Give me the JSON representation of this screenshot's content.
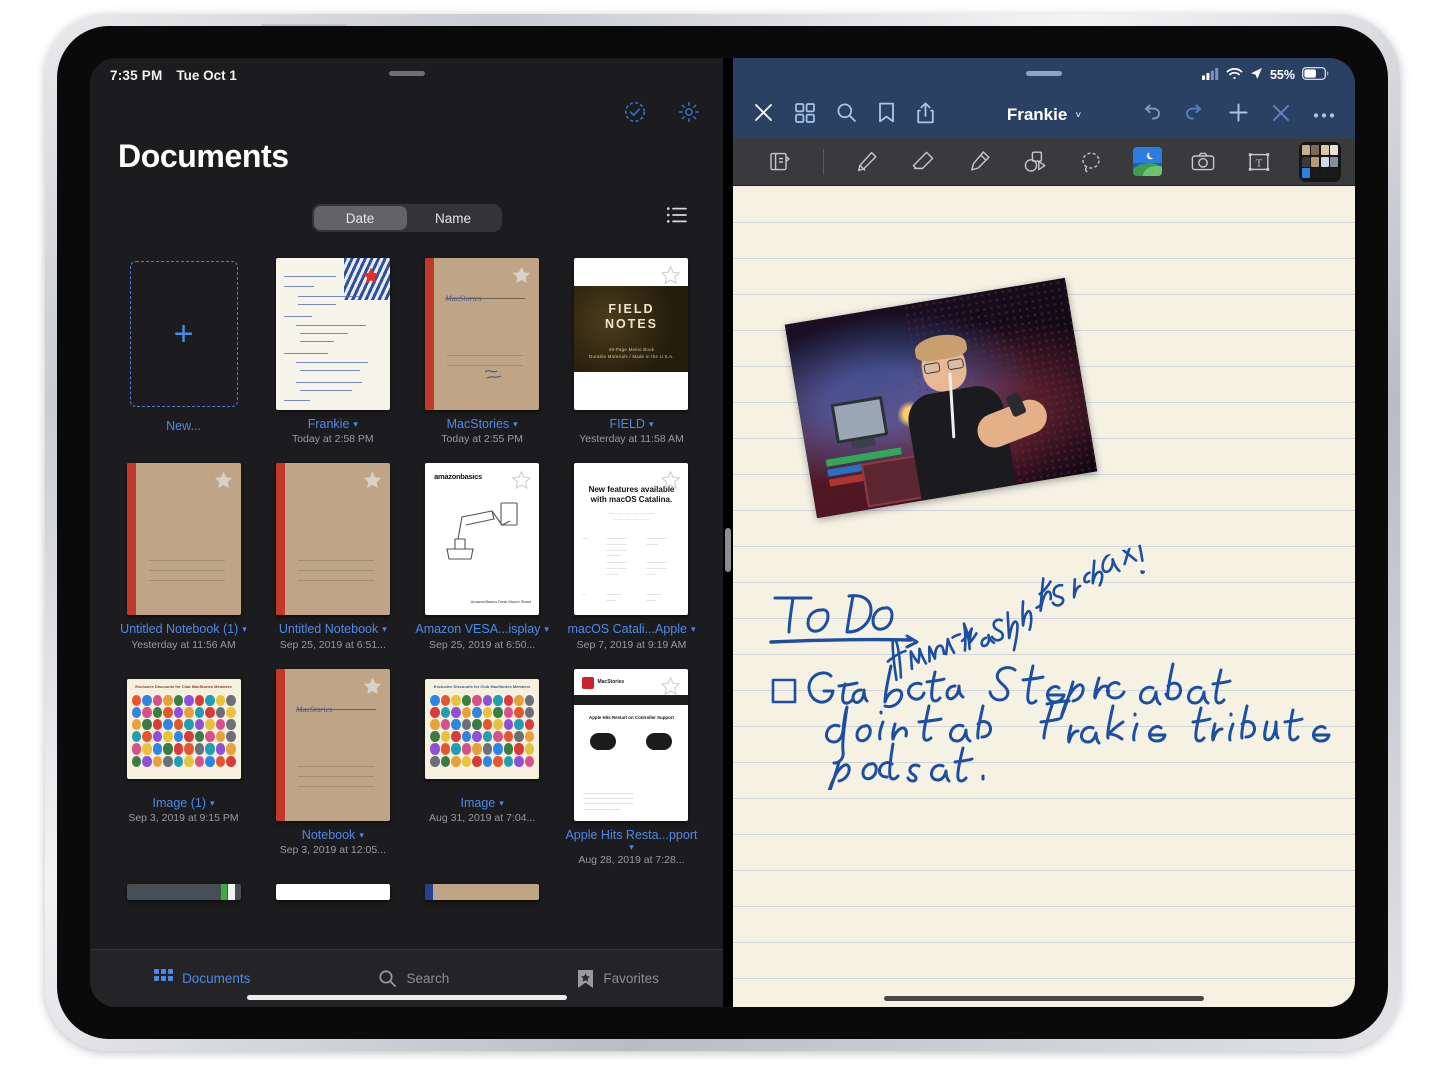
{
  "device": {
    "frame": "ipad-pro",
    "home_indicator": true
  },
  "left_pane": {
    "status_bar": {
      "time": "7:35 PM",
      "date": "Tue Oct 1"
    },
    "page_title": "Documents",
    "header_icons": [
      {
        "name": "select-circle-icon",
        "label": "Select"
      },
      {
        "name": "gear-icon",
        "label": "Settings"
      }
    ],
    "sort": {
      "options": [
        {
          "label": "Date",
          "selected": true
        },
        {
          "label": "Name",
          "selected": false
        }
      ],
      "list_view_icon": "list-icon"
    },
    "new_item": {
      "label": "New...",
      "icon": "plus-icon"
    },
    "documents": [
      {
        "title": "Frankie",
        "date": "Today at 2:58 PM",
        "thumb": "handnotes",
        "starred": false,
        "chevron": true
      },
      {
        "title": "MacStories",
        "date": "Today at 2:55 PM",
        "thumb": "kraft",
        "starred": true,
        "chevron": true
      },
      {
        "title": "FIELD",
        "date": "Yesterday at 11:58 AM",
        "thumb": "fieldnotes",
        "starred": true,
        "chevron": true
      },
      {
        "title": "Untitled Notebook (1)",
        "date": "Yesterday at 11:56 AM",
        "thumb": "kraft",
        "starred": true,
        "chevron": true
      },
      {
        "title": "Untitled Notebook",
        "date": "Sep 25, 2019 at 6:51...",
        "thumb": "kraft",
        "starred": true,
        "chevron": true
      },
      {
        "title": "Amazon VESA...isplay",
        "date": "Sep 25, 2019 at 6:50...",
        "thumb": "amazon",
        "starred": true,
        "chevron": true
      },
      {
        "title": "macOS Catali...Apple",
        "date": "Sep 7, 2019 at 9:19 AM",
        "thumb": "catalina",
        "starred": true,
        "chevron": true
      },
      {
        "title": "Image (1)",
        "date": "Sep 3, 2019 at 9:15 PM",
        "thumb": "emoji",
        "starred": false,
        "chevron": true
      },
      {
        "title": "Notebook",
        "date": "Sep 3, 2019 at 12:05...",
        "thumb": "kraft",
        "starred": true,
        "chevron": true
      },
      {
        "title": "Image",
        "date": "Aug 31, 2019 at 7:04...",
        "thumb": "emoji",
        "starred": false,
        "chevron": true
      },
      {
        "title": "Apple Hits Resta...pport",
        "date": "Aug 28, 2019 at 7:28...",
        "thumb": "machits",
        "starred": true,
        "chevron": true
      }
    ],
    "thumbnail_text": {
      "field_notes_title": "FIELD\nNOTES",
      "field_notes_sub": "48-Page Memo Book\nDurable Materials / Made in the U.S.A.",
      "amazon_brand": "amazonbasics",
      "amazon_caption": "AmazonBasics Desk Mount Stand",
      "catalina_heading": "New features available\nwith macOS Catalina.",
      "kraft_title": "MacStories",
      "machits_heading": "Apple Hits Restart on Controller Support"
    },
    "tabs": [
      {
        "label": "Documents",
        "icon": "grid-icon",
        "selected": true
      },
      {
        "label": "Search",
        "icon": "search-icon",
        "selected": false
      },
      {
        "label": "Favorites",
        "icon": "bookmark-star-icon",
        "selected": false
      }
    ]
  },
  "right_pane": {
    "status_bar": {
      "battery_percent": "55%",
      "icons": [
        "cellular-icon",
        "wifi-icon",
        "location-icon",
        "battery-icon"
      ]
    },
    "toolbar": {
      "title": "Frankie",
      "title_chevron": "˅",
      "left_buttons": [
        {
          "name": "close-icon",
          "label": "Close"
        },
        {
          "name": "grid-icon",
          "label": "Pages"
        },
        {
          "name": "search-icon",
          "label": "Search"
        },
        {
          "name": "bookmark-icon",
          "label": "Bookmark"
        },
        {
          "name": "share-icon",
          "label": "Share"
        }
      ],
      "right_buttons": [
        {
          "name": "undo-icon",
          "label": "Undo"
        },
        {
          "name": "redo-icon",
          "label": "Redo"
        },
        {
          "name": "plus-icon",
          "label": "Add"
        },
        {
          "name": "close-x-icon",
          "label": "Close Tool"
        },
        {
          "name": "more-icon",
          "label": "More"
        }
      ]
    },
    "tools": [
      {
        "name": "page-layout-icon",
        "selected": false
      },
      {
        "name": "pen-icon",
        "selected": false
      },
      {
        "name": "eraser-icon",
        "selected": false
      },
      {
        "name": "highlighter-icon",
        "selected": false
      },
      {
        "name": "shapes-icon",
        "selected": false
      },
      {
        "name": "lasso-icon",
        "selected": false
      },
      {
        "name": "photo-icon",
        "selected": true
      },
      {
        "name": "camera-icon",
        "selected": false
      },
      {
        "name": "text-box-icon",
        "selected": false
      },
      {
        "name": "sticker-icon",
        "selected": false
      },
      {
        "name": "photo-picker-thumbnail-icon",
        "selected": false
      }
    ],
    "note": {
      "paper": "ruled",
      "photo_caption": "Frankie say Relax!",
      "heading": "To Do",
      "checkbox_item": "Get back to Stephen about doing that Frankie tribute podcast."
    }
  },
  "colors": {
    "accent_blue": "#4d8ae8",
    "notes_chrome": "#2b4164",
    "tool_bar": "#3a3a3c",
    "paper": "#f5f2e4",
    "ink": "#1c4fa1",
    "app_background": "#1c1c1e"
  }
}
